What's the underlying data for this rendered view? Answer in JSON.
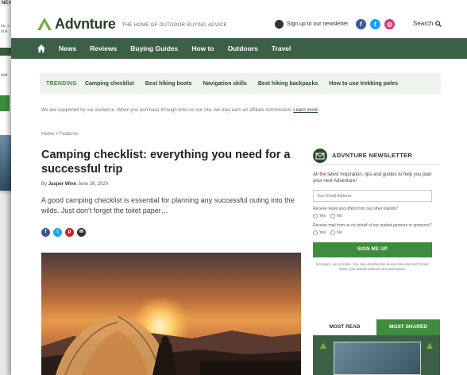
{
  "background_window": {
    "top_label": "NEV",
    "snippets": [
      "on, s",
      "st A",
      "ierd"
    ]
  },
  "header": {
    "logo_text": "Advnture",
    "tagline": "THE HOME OF OUTDOOR BUYING ADVICE",
    "newsletter_link": "Sign up to our newsletter",
    "search_label": "Search",
    "social": [
      {
        "icon": "facebook-icon",
        "glyph": "f",
        "color": "#3b5998"
      },
      {
        "icon": "twitter-icon",
        "glyph": "t",
        "color": "#1da1f2"
      },
      {
        "icon": "instagram-icon",
        "glyph": "◎",
        "color": "#e1306c"
      }
    ]
  },
  "nav": {
    "items": [
      "News",
      "Reviews",
      "Buying Guides",
      "How to",
      "Outdoors",
      "Travel"
    ]
  },
  "trending": {
    "label": "TRENDING",
    "items": [
      "Camping checklist",
      "Best hiking boots",
      "Navigation skills",
      "Best hiking backpacks",
      "How to use trekking poles"
    ]
  },
  "disclaimer": {
    "text": "We are supported by our audience. When you purchase through links on our site, we may earn an affiliate commission.",
    "link": "Learn more"
  },
  "breadcrumb": {
    "home": "Home",
    "sep": ">",
    "section": "Features"
  },
  "article": {
    "title": "Camping checklist: everything you need for a successful trip",
    "by": "By",
    "author": "Jasper Winn",
    "date": "June 26, 2020",
    "lede": "A good camping checklist is essential for planning any successful outing into the wilds. Just don't forget the toilet paper…",
    "shares": [
      {
        "icon": "facebook-share-icon",
        "glyph": "f",
        "color": "#3b5998"
      },
      {
        "icon": "twitter-share-icon",
        "glyph": "t",
        "color": "#1da1f2"
      },
      {
        "icon": "pinterest-share-icon",
        "glyph": "p",
        "color": "#cb2027"
      },
      {
        "icon": "email-share-icon",
        "glyph": "✉",
        "color": "#333333"
      }
    ]
  },
  "newsletter": {
    "title": "ADVNTURE NEWSLETTER",
    "description": "All the latest inspiration, tips and guides to help you plan your next Adventure!",
    "email_placeholder": "Your Email Address",
    "q1": "Receive news and offers from our other brands?",
    "q2": "Receive mail from us on behalf of our trusted partners or sponsors?",
    "yes": "Yes",
    "no": "No",
    "button": "SIGN ME UP",
    "fine_print": "No spam, we promise. You can unsubscribe at any time and we'll never share your details without your permission."
  },
  "most": {
    "tab_read": "MOST READ",
    "tab_shared": "MOST SHARED"
  },
  "colors": {
    "nav_green": "#3c6046",
    "accent_green": "#3e8c3e",
    "trend_bg": "#eef3ee"
  }
}
